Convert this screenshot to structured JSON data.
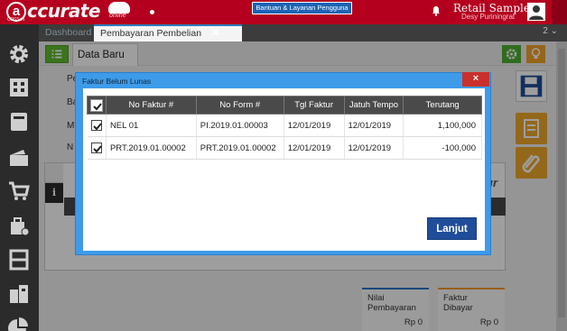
{
  "topbar": {
    "logo_letter": "a",
    "logo_text": "ccurate",
    "logo_online": "online",
    "logo_sub": "CPSSoft",
    "help_label": "Bantuan & Layanan Pengguna",
    "user_name": "Retail Sample",
    "user_sub": "Desy Puriningrat"
  },
  "tabs": {
    "dashboard": "Dashboard",
    "payment": "Pembayaran Pembelian",
    "count": "2"
  },
  "subtoolbar": {
    "data_tab": "Data Baru"
  },
  "form_labels": [
    "Pe",
    "Ba",
    "M",
    "N"
  ],
  "detail": {
    "ghost_label": "ur"
  },
  "summary": {
    "payment_label": "Nilai Pembayaran",
    "payment_value": "Rp 0",
    "invoice_label": "Faktur Dibayar",
    "invoice_value": "Rp 0"
  },
  "dialog": {
    "title": "Faktur Belum Lunas",
    "close_label": "×",
    "columns": [
      "No Faktur #",
      "No Form #",
      "Tgl Faktur",
      "Jatuh Tempo",
      "Terutang"
    ],
    "rows": [
      {
        "checked": true,
        "no_faktur": "NEL 01",
        "no_form": "PI.2019.01.00003",
        "tgl": "12/01/2019",
        "jatuh_tempo": "12/01/2019",
        "terutang": "1,100,000"
      },
      {
        "checked": true,
        "no_faktur": "PRT.2019.01.00002",
        "no_form": "PRT.2019.01.00002",
        "tgl": "12/01/2019",
        "jatuh_tempo": "12/01/2019",
        "terutang": "-100,000"
      }
    ],
    "next_button": "Lanjut"
  },
  "colors": {
    "brand_red": "#b4001e",
    "accent_blue": "#3d9be9",
    "button_blue": "#1f4d9a",
    "green": "#5fbb2f",
    "orange": "#efa82d"
  }
}
